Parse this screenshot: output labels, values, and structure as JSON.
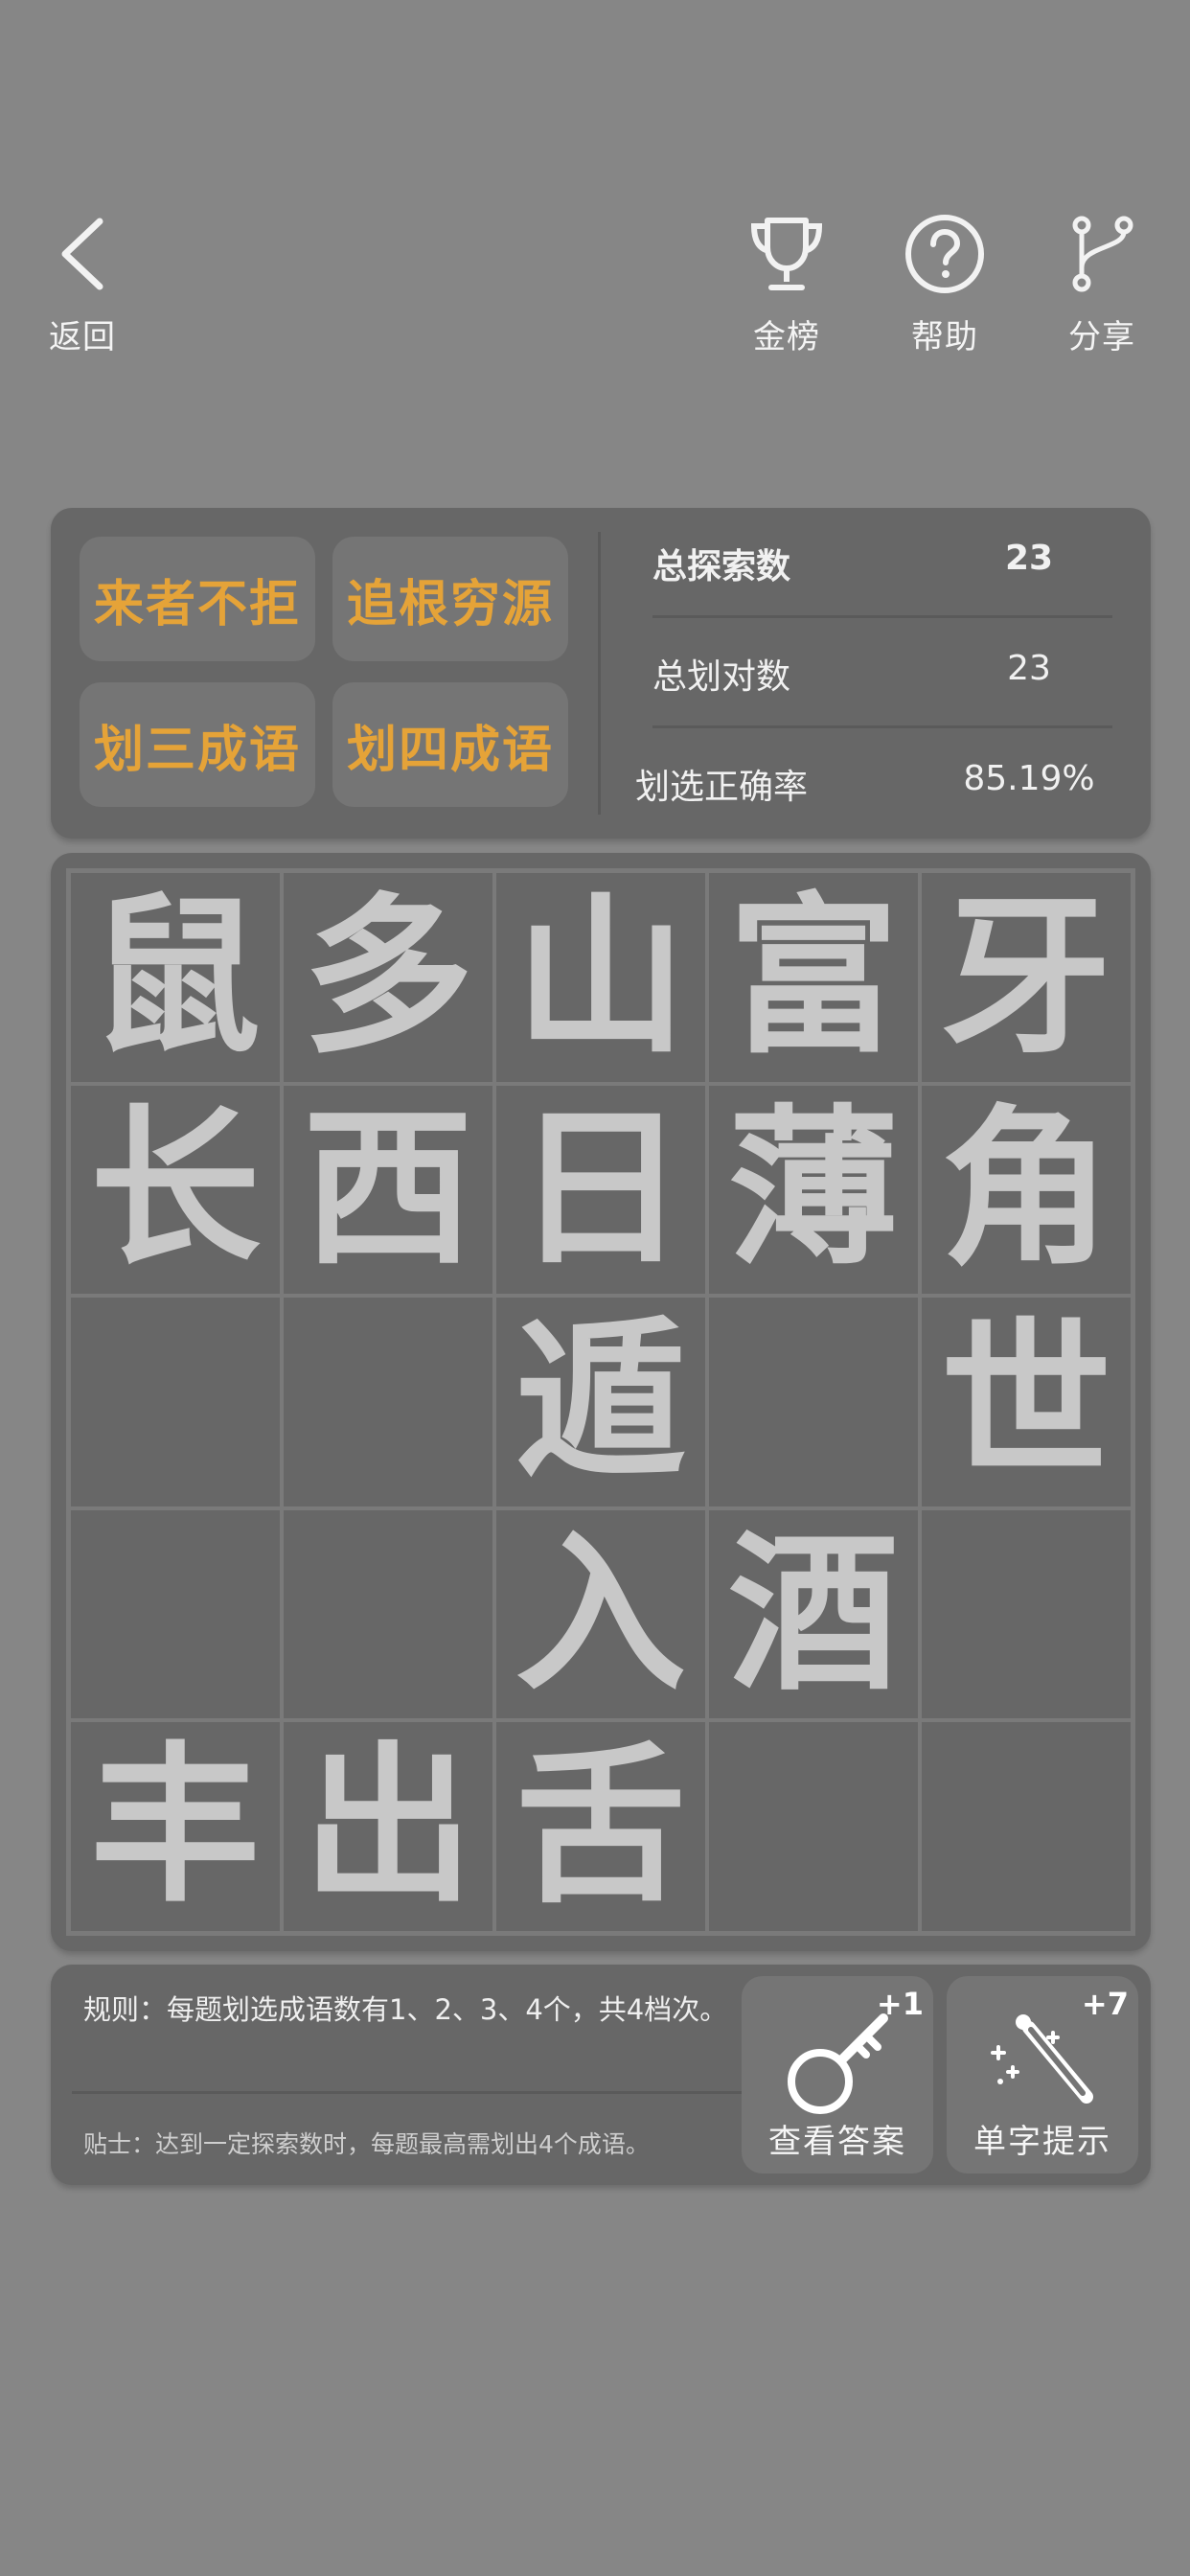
{
  "nav": {
    "back": {
      "label": "返回",
      "icon": "chevron-left-icon"
    },
    "rank": {
      "label": "金榜",
      "icon": "trophy-icon"
    },
    "help": {
      "label": "帮助",
      "icon": "question-circle-icon"
    },
    "share": {
      "label": "分享",
      "icon": "share-branch-icon"
    }
  },
  "modes": [
    "来者不拒",
    "追根穷源",
    "划三成语",
    "划四成语"
  ],
  "stats": [
    {
      "label": "总探索数",
      "value": "23"
    },
    {
      "label": "总划对数",
      "value": "23"
    },
    {
      "label": "划选正确率",
      "value": "85.19%"
    }
  ],
  "board": [
    [
      "鼠",
      "多",
      "山",
      "富",
      "牙"
    ],
    [
      "长",
      "西",
      "日",
      "薄",
      "角"
    ],
    [
      "",
      "",
      "遁",
      "",
      "世"
    ],
    [
      "",
      "",
      "入",
      "酒",
      ""
    ],
    [
      "丰",
      "出",
      "舌",
      "",
      ""
    ]
  ],
  "rules": {
    "text": "规则：每题划选成语数有1、2、3、4个，共4档次。",
    "tip": "贴士：达到一定探索数时，每题最高需划出4个成语。"
  },
  "tools": {
    "answer": {
      "label": "查看答案",
      "badge": "+1",
      "icon": "key-icon"
    },
    "hint": {
      "label": "单字提示",
      "badge": "+7",
      "icon": "magic-wand-icon"
    }
  },
  "colors": {
    "background": "#868686",
    "panel": "#676767",
    "button": "#757575",
    "accent": "#e5a338",
    "board_text": "#c8c8c8"
  }
}
